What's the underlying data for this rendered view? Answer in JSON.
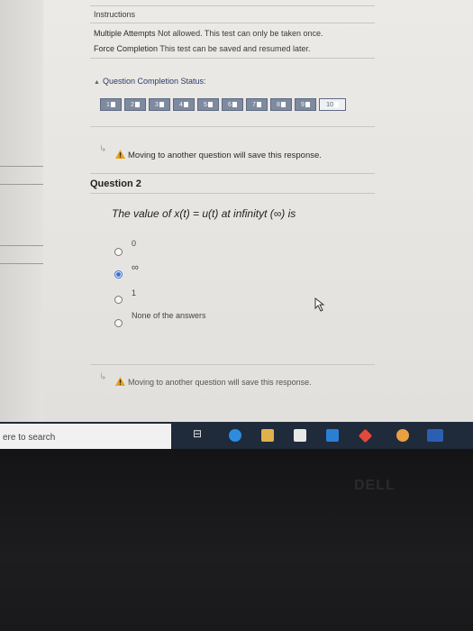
{
  "instructions": {
    "title": "Instructions",
    "attempts_label": "Multiple Attempts",
    "attempts_value": "Not allowed. This test can only be taken once.",
    "force_label": "Force Completion",
    "force_value": "This test can be saved and resumed later."
  },
  "status": {
    "title": "Question Completion Status:",
    "questions": [
      "1",
      "2",
      "3",
      "4",
      "5",
      "6",
      "7",
      "8",
      "9",
      "10"
    ]
  },
  "warning": {
    "text": "Moving to another question will save this response."
  },
  "question": {
    "header": "Question 2",
    "text": "The value of x(t) = u(t) at infinityt (∞) is",
    "options": [
      {
        "label": "0",
        "selected": false
      },
      {
        "label": "∞",
        "selected": true
      },
      {
        "label": "1",
        "selected": false
      },
      {
        "label": "None of the answers",
        "selected": false
      }
    ]
  },
  "taskbar": {
    "search_text": "ere to search"
  },
  "bezel": {
    "brand": "DELL"
  },
  "colors": {
    "accent": "#3a6fd1",
    "warning": "#e8a21a",
    "status_box": "#7e8aa0",
    "taskbar": "#1f2a3a"
  }
}
